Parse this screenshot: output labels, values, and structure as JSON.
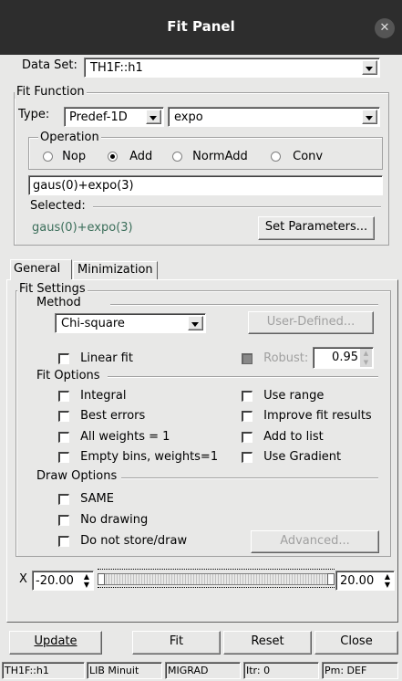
{
  "window": {
    "title": "Fit Panel"
  },
  "data_set": {
    "label": "Data Set:",
    "value": "TH1F::h1"
  },
  "fit_function": {
    "group_label": "Fit Function",
    "type_label": "Type:",
    "type_value": "Predef-1D",
    "func_value": "expo",
    "operation": {
      "label": "Operation",
      "options": [
        "Nop",
        "Add",
        "NormAdd",
        "Conv"
      ],
      "selected": "Add"
    },
    "formula": "gaus(0)+expo(3)",
    "selected_label": "Selected:",
    "selected_value": "gaus(0)+expo(3)",
    "set_params_label": "Set Parameters..."
  },
  "tabs": [
    "General",
    "Minimization"
  ],
  "fit_settings": {
    "group_label": "Fit Settings",
    "method_label": "Method",
    "method_value": "Chi-square",
    "user_defined_label": "User-Defined...",
    "linear_fit_label": "Linear fit",
    "robust_label": "Robust:",
    "robust_value": "0.95",
    "fit_options_label": "Fit Options",
    "options_left": [
      "Integral",
      "Best errors",
      "All weights = 1",
      "Empty bins, weights=1"
    ],
    "options_right": [
      "Use range",
      "Improve fit results",
      "Add to list",
      "Use Gradient"
    ],
    "draw_options_label": "Draw Options",
    "draw_options": [
      "SAME",
      "No drawing",
      "Do not store/draw"
    ],
    "advanced_label": "Advanced..."
  },
  "range": {
    "axis_label": "X",
    "min": "-20.00",
    "max": "20.00"
  },
  "buttons": {
    "update": "Update",
    "fit": "Fit",
    "reset": "Reset",
    "close": "Close"
  },
  "status_bar": [
    "TH1F::h1",
    "LIB Minuit",
    "MIGRAD",
    "Itr: 0",
    "Pm: DEF"
  ]
}
